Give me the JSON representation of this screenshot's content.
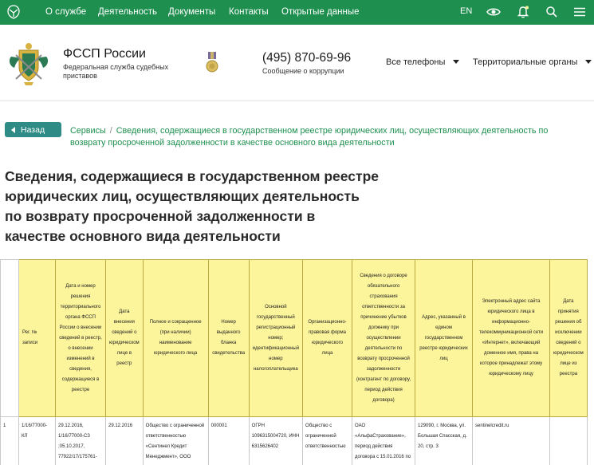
{
  "topnav": {
    "links": [
      "О службе",
      "Деятельность",
      "Документы",
      "Контакты",
      "Открытые данные"
    ],
    "lang": "EN",
    "icons": [
      "eye-icon",
      "bell-icon",
      "search-icon",
      "menu-icon"
    ]
  },
  "header": {
    "org_name": "ФССП России",
    "org_sub": "Федеральная служба судебных приставов",
    "phone": "(495) 870-69-96",
    "phone_sub": "Сообщение о коррупции",
    "dropdown_phones": "Все телефоны",
    "dropdown_regions": "Территориальные органы"
  },
  "breadcrumb": {
    "back": "Назад",
    "root": "Сервисы",
    "current": "Сведения, содержащиеся в государственном реестре юридических лиц, осуществляющих деятельность по возврату просроченной задолженности в качестве основного вида деятельности"
  },
  "page": {
    "title": "Сведения, содержащиеся в государственном реестре юридических лиц, осуществляющих деятельность по возврату просроченной задолженности в качестве основного вида деятельности"
  },
  "table": {
    "headers": [
      "",
      "Рег. № записи",
      "Дата и номер решения территориального органа ФССП России о внесении сведений в реестр, о внесении изменений в сведения, содержащиеся в реестре",
      "Дата внесения сведений о юридическом лице в реестр",
      "Полное и сокращенное (при наличии) наименование юридического лица",
      "Номер выданного бланка свидетельства",
      "Основной государственный регистрационный номер; идентификационный номер налогоплательщика",
      "Организационно-правовая форма юридического лица",
      "Сведения о договоре обязательного страхования ответственности за причинение убытков должнику при осуществлении деятельности по возврату просроченной задолженности (контрагент по договору, период действия договора)",
      "Адрес, указанный в едином государственном реестре юридических лиц",
      "Электронный адрес сайта юридического лица в информационно-телекоммуникационной сети «Интернет», включающий доменное имя, права на которое принадлежат этому юридическому лицу",
      "Дата принятия решения об исключении сведений о юридическом лице из реестра"
    ],
    "rows": [
      [
        "1",
        "1/16/77000-КЛ",
        "29.12.2016, 1/16/77000-СЗ ;05.10.2017, 77922/17/175761-",
        "29.12.2016",
        "Общество с ограниченной ответственностью «Сентинел Кредит Менеджмент», ООО «СКМ»",
        "000001",
        "ОГРН 1096315004720, ИНН 6315626402",
        "Общество с ограниченной ответственностью",
        "ОАО «АльфаСтрахование», период действия договора с 15.01.2016 по",
        "129090, г. Москва, ул. Большая Спасская, д. 20, стр. 3",
        "sentinelcredit.ru",
        ""
      ]
    ]
  },
  "colors": {
    "nav_green": "#1e8f4e",
    "back_button": "#2f8b86",
    "header_yellow": "#fdf59c"
  }
}
